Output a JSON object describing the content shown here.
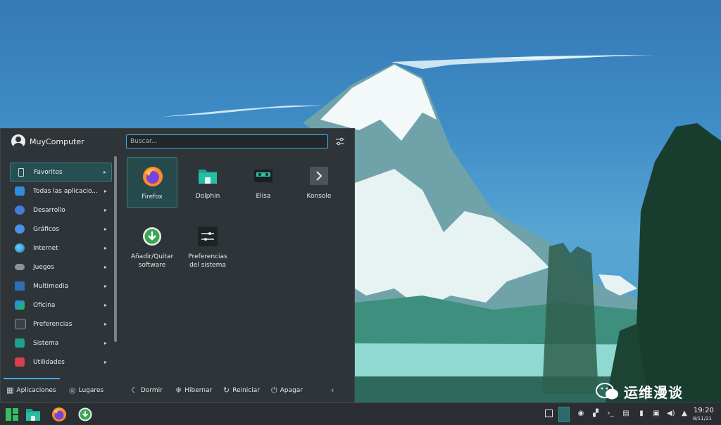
{
  "user": {
    "name": "MuyComputer"
  },
  "search": {
    "placeholder": "Buscar..."
  },
  "categories": [
    {
      "label": "Favoritos",
      "icon": "bookmark-icon"
    },
    {
      "label": "Todas las aplicacio...",
      "icon": "apps-grid-icon"
    },
    {
      "label": "Desarrollo",
      "icon": "development-icon"
    },
    {
      "label": "Gráficos",
      "icon": "graphics-icon"
    },
    {
      "label": "Internet",
      "icon": "globe-icon"
    },
    {
      "label": "Juegos",
      "icon": "gamepad-icon"
    },
    {
      "label": "Multimedia",
      "icon": "multimedia-icon"
    },
    {
      "label": "Oficina",
      "icon": "office-icon"
    },
    {
      "label": "Preferencias",
      "icon": "preferences-icon"
    },
    {
      "label": "Sistema",
      "icon": "system-icon"
    },
    {
      "label": "Utilidades",
      "icon": "utilities-icon"
    }
  ],
  "favorites": [
    {
      "label": "Firefox",
      "icon": "firefox-icon"
    },
    {
      "label": "Dolphin",
      "icon": "folder-icon"
    },
    {
      "label": "Elisa",
      "icon": "music-player-icon"
    },
    {
      "label": "Konsole",
      "icon": "terminal-icon"
    },
    {
      "label": "Añadir/Quitar software",
      "icon": "download-icon"
    },
    {
      "label": "Preferencias del sistema",
      "icon": "settings-sliders-icon"
    }
  ],
  "footer": {
    "apps_tab": "Aplicaciones",
    "places_tab": "Lugares",
    "sleep": "Dormir",
    "hibernate": "Hibernar",
    "restart": "Reiniciar",
    "shutdown": "Apagar"
  },
  "clock": {
    "time": "19:20",
    "date": "8/11/21"
  },
  "watermark": {
    "text": "运维漫谈"
  },
  "colors": {
    "accent": "#3daee9",
    "panel": "#2f3438",
    "taskbar": "#2a2e32",
    "highlight": "#264f52"
  }
}
